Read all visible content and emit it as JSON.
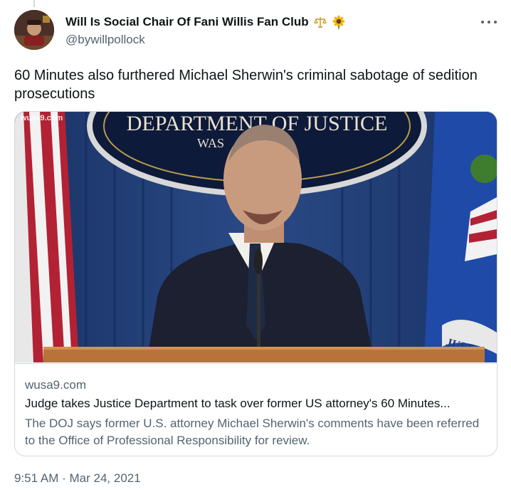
{
  "author": {
    "display_name": "Will Is Social Chair Of Fani Willis Fan Club",
    "handle": "@bywillpollock",
    "emojis": [
      "scales-emoji",
      "sunflower-emoji"
    ]
  },
  "tweet": {
    "text": "60 Minutes also furthered Michael Sherwin's criminal sabotage of sedition prosecutions",
    "time": "9:51 AM",
    "separator": "·",
    "date": "Mar 24, 2021"
  },
  "card": {
    "image_watermark": "wusa9.com",
    "seal_text_top": "DEPARTMENT OF JUSTICE",
    "seal_text_partial": "WAS",
    "flag_text": "JUST",
    "domain": "wusa9.com",
    "title": "Judge takes Justice Department to task over former US attorney's 60 Minutes...",
    "description": "The DOJ says former U.S. attorney Michael Sherwin's comments have been referred to the Office of Professional Responsibility for review."
  },
  "colors": {
    "text_primary": "#0f1419",
    "text_secondary": "#536471",
    "border": "#cfd9de",
    "curtain_blue": "#1e3a6e"
  }
}
